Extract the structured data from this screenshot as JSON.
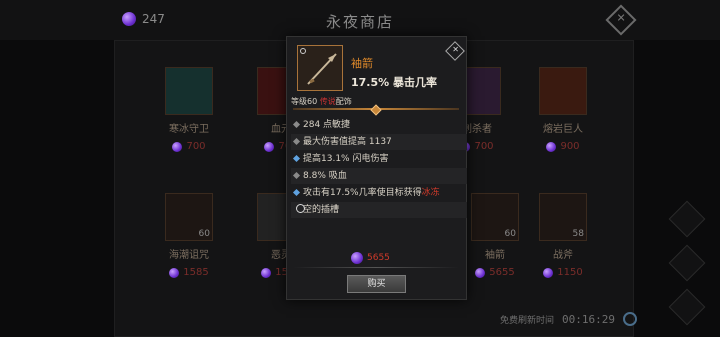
{
  "header": {
    "currency_amount": "247",
    "title": "永夜商店"
  },
  "shop_items": [
    {
      "name": "寒冰守卫",
      "price": "700",
      "level": ""
    },
    {
      "name": "血元",
      "price": "700",
      "level": ""
    },
    {
      "name": "刺杀者",
      "price": "700",
      "level": ""
    },
    {
      "name": "熔岩巨人",
      "price": "900",
      "level": ""
    },
    {
      "name": "海潮诅咒",
      "price": "1585",
      "level": "60"
    },
    {
      "name": "恶灵",
      "price": "1585",
      "level": ""
    },
    {
      "name": "袖箭",
      "price": "5655",
      "level": "60"
    },
    {
      "name": "战斧",
      "price": "1150",
      "level": "58"
    }
  ],
  "refresh": {
    "label": "免费刷新时间",
    "timer": "00:16:29"
  },
  "tooltip": {
    "item_name": "袖箭",
    "main_stat": "17.5% 暴击几率",
    "level_prefix": "等级60 ",
    "level_class": "传说",
    "level_suffix": "配饰",
    "lines": [
      {
        "text": "284 点敏捷",
        "bullet": "gray"
      },
      {
        "text": "最大伤害值提高 1137",
        "bullet": "gray"
      },
      {
        "text": "提高13.1% 闪电伤害",
        "bullet": "blue"
      },
      {
        "text": "8.8% 吸血",
        "bullet": "gray"
      },
      {
        "text": "攻击有17.5%几率使目标获得",
        "highlight": "冰冻",
        "bullet": "blue"
      },
      {
        "text": "空的插槽",
        "bullet": "socket"
      }
    ],
    "price": "5655",
    "buy_label": "购买"
  },
  "colors": {
    "accent_orange": "#e08a2a",
    "price_red": "#d03a2a",
    "gem_purple": "#6b2fd0"
  }
}
